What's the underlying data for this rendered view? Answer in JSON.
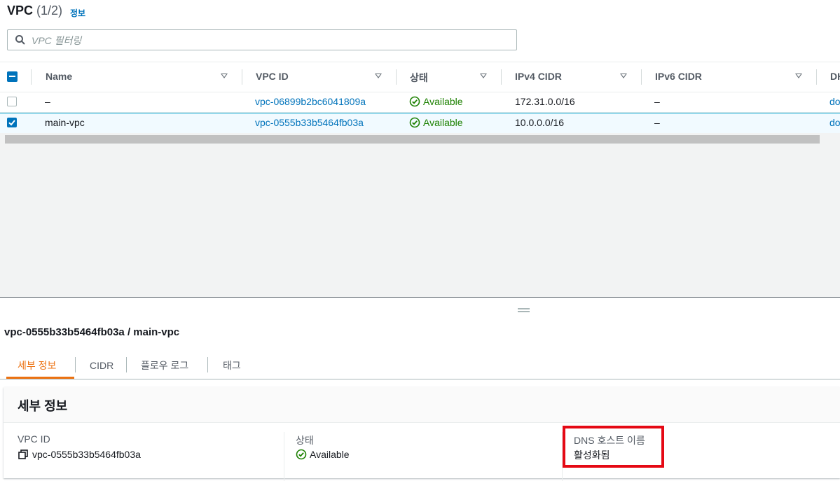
{
  "header": {
    "title": "VPC",
    "count": "(1/2)",
    "info": "정보",
    "search_placeholder": "VPC 필터링"
  },
  "table": {
    "columns": [
      "Name",
      "VPC ID",
      "상태",
      "IPv4 CIDR",
      "IPv6 CIDR",
      "DH"
    ],
    "rows": [
      {
        "name": "–",
        "vpc_id": "vpc-06899b2bc6041809a",
        "status": "Available",
        "ipv4": "172.31.0.0/16",
        "ipv6": "–",
        "dhcp": "do",
        "selected": false
      },
      {
        "name": "main-vpc",
        "vpc_id": "vpc-0555b33b5464fb03a",
        "status": "Available",
        "ipv4": "10.0.0.0/16",
        "ipv6": "–",
        "dhcp": "do",
        "selected": true
      }
    ]
  },
  "detail": {
    "title": "vpc-0555b33b5464fb03a / main-vpc",
    "tabs": [
      "세부 정보",
      "CIDR",
      "플로우 로그",
      "태그"
    ],
    "active_tab": "세부 정보",
    "panel_title": "세부 정보",
    "fields": [
      {
        "label": "VPC ID",
        "value": "vpc-0555b33b5464fb03a"
      },
      {
        "label": "상태",
        "value": "Available"
      },
      {
        "label": "DNS 호스트 이름",
        "value": "활성화됨"
      }
    ]
  },
  "colors": {
    "link": "#0073bb",
    "success": "#1d8102",
    "active_tab": "#ec7211",
    "highlight": "#e50914"
  }
}
